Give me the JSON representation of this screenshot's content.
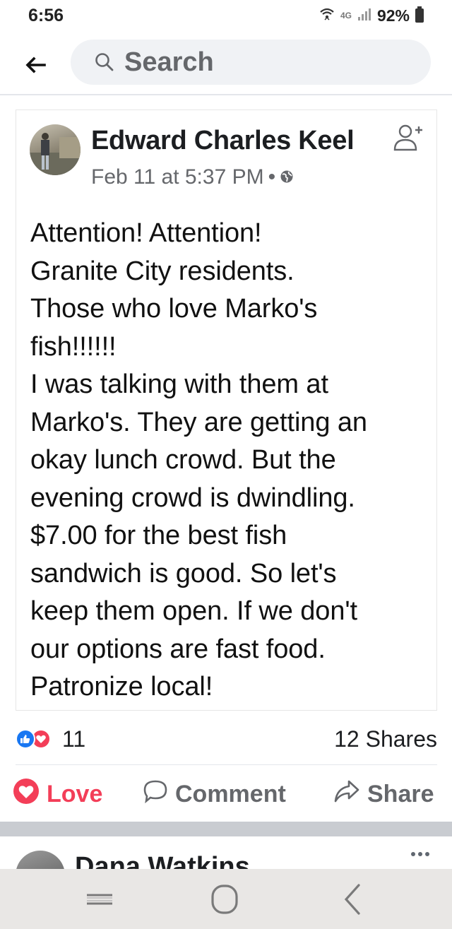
{
  "status_bar": {
    "time": "6:56",
    "network": "4G",
    "battery": "92%"
  },
  "search": {
    "placeholder": "Search"
  },
  "post": {
    "author": "Edward Charles Keel",
    "timestamp": "Feb 11 at 5:37 PM",
    "separator": "•",
    "privacy_icon": "globe-icon",
    "body": "Attention! Attention!\nGranite City residents.\nThose who love Marko's\nfish!!!!!!\nI was talking with them at\nMarko's. They are getting an\nokay lunch crowd. But the\nevening crowd is dwindling.\n$7.00 for the best fish\nsandwich is good. So let's\nkeep them open. If we don't\nour options are fast food.\nPatronize local!",
    "reaction_count": "11",
    "shares": "12 Shares"
  },
  "actions": {
    "love": "Love",
    "comment": "Comment",
    "share": "Share"
  },
  "next_post": {
    "author": "Dana Watkins"
  },
  "colors": {
    "like_blue": "#1877f2",
    "love_red": "#f33e58",
    "secondary_text": "#65676b",
    "search_bg": "#f0f2f5",
    "nav_bar_bg": "#e9e7e5"
  }
}
